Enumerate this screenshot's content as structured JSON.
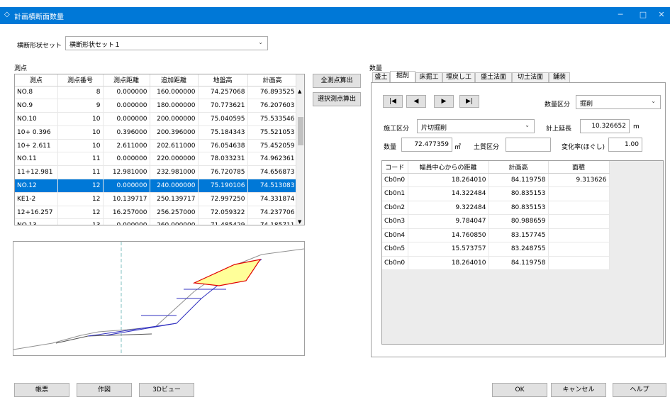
{
  "window": {
    "title": "計画横断面数量"
  },
  "shape_set": {
    "label": "横断形状セット",
    "value": "横断形状セット１"
  },
  "stations_label": "測点",
  "stations_table": {
    "columns": [
      "測点",
      "測点番号",
      "測点距離",
      "追加距離",
      "地盤高",
      "計画高"
    ],
    "rows": [
      [
        "NO.8",
        "8",
        "0.000000",
        "160.000000",
        "74.257068",
        "76.893525"
      ],
      [
        "NO.9",
        "9",
        "0.000000",
        "180.000000",
        "70.773621",
        "76.207603"
      ],
      [
        "NO.10",
        "10",
        "0.000000",
        "200.000000",
        "75.040595",
        "75.533546"
      ],
      [
        "10+ 0.396",
        "10",
        "0.396000",
        "200.396000",
        "75.184343",
        "75.521053"
      ],
      [
        "10+ 2.611",
        "10",
        "2.611000",
        "202.611000",
        "76.054638",
        "75.452059"
      ],
      [
        "NO.11",
        "11",
        "0.000000",
        "220.000000",
        "78.033231",
        "74.962361"
      ],
      [
        "11+12.981",
        "11",
        "12.981000",
        "232.981000",
        "76.720785",
        "74.656873"
      ],
      [
        "NO.12",
        "12",
        "0.000000",
        "240.000000",
        "75.190106",
        "74.513083"
      ],
      [
        "KE1-2",
        "12",
        "10.139717",
        "250.139717",
        "72.997250",
        "74.331874"
      ],
      [
        "12+16.257",
        "12",
        "16.257000",
        "256.257000",
        "72.059322",
        "74.237706"
      ],
      [
        "NO.13",
        "13",
        "0.000000",
        "260.000000",
        "71.485429",
        "74.185711"
      ]
    ],
    "selected_index": 7
  },
  "calc_buttons": {
    "all": "全測点算出",
    "selected": "選択測点算出"
  },
  "quantity_label": "数量",
  "tabs": [
    "盛土",
    "掘削",
    "床掘工",
    "埋戻し工",
    "盛土法面",
    "切土法面",
    "舗装"
  ],
  "active_tab": "掘削",
  "nav_buttons": [
    "|◀",
    "◀",
    "▶",
    "▶|"
  ],
  "quantity_class": {
    "label": "数量区分",
    "value": "掘削"
  },
  "work_class": {
    "label": "施工区分",
    "value": "片切掘削"
  },
  "plan_length": {
    "label": "計上延長",
    "value": "10.326652",
    "unit": "m"
  },
  "quantity": {
    "label": "数量",
    "value": "72.477359",
    "unit": "㎡"
  },
  "soil_class": {
    "label": "土質区分",
    "value": ""
  },
  "change_rate": {
    "label": "変化率(ほぐし)",
    "value": "1.00"
  },
  "coord_table": {
    "columns": [
      "コード",
      "幅員中心からの距離",
      "計画高",
      "面積"
    ],
    "rows": [
      [
        "Cb0n0",
        "18.264010",
        "84.119758",
        "9.313626"
      ],
      [
        "Cb0n1",
        "14.322484",
        "80.835153",
        ""
      ],
      [
        "Cb0n2",
        "9.322484",
        "80.835153",
        ""
      ],
      [
        "Cb0n3",
        "9.784047",
        "80.988659",
        ""
      ],
      [
        "Cb0n4",
        "14.760850",
        "83.157745",
        ""
      ],
      [
        "Cb0n5",
        "15.573757",
        "83.248755",
        ""
      ],
      [
        "Cb0n0",
        "18.264010",
        "84.119758",
        ""
      ]
    ]
  },
  "bottom_buttons": {
    "report": "帳票",
    "draw": "作図",
    "view3d": "3Dビュー",
    "ok": "OK",
    "cancel": "キャンセル",
    "help": "ヘルプ"
  },
  "colors": {
    "titlebar": "#0078d7",
    "selection": "#0078d7",
    "fill_area": "#ffff99",
    "fill_outline": "#e00000",
    "section_lines": "#3030c0"
  }
}
